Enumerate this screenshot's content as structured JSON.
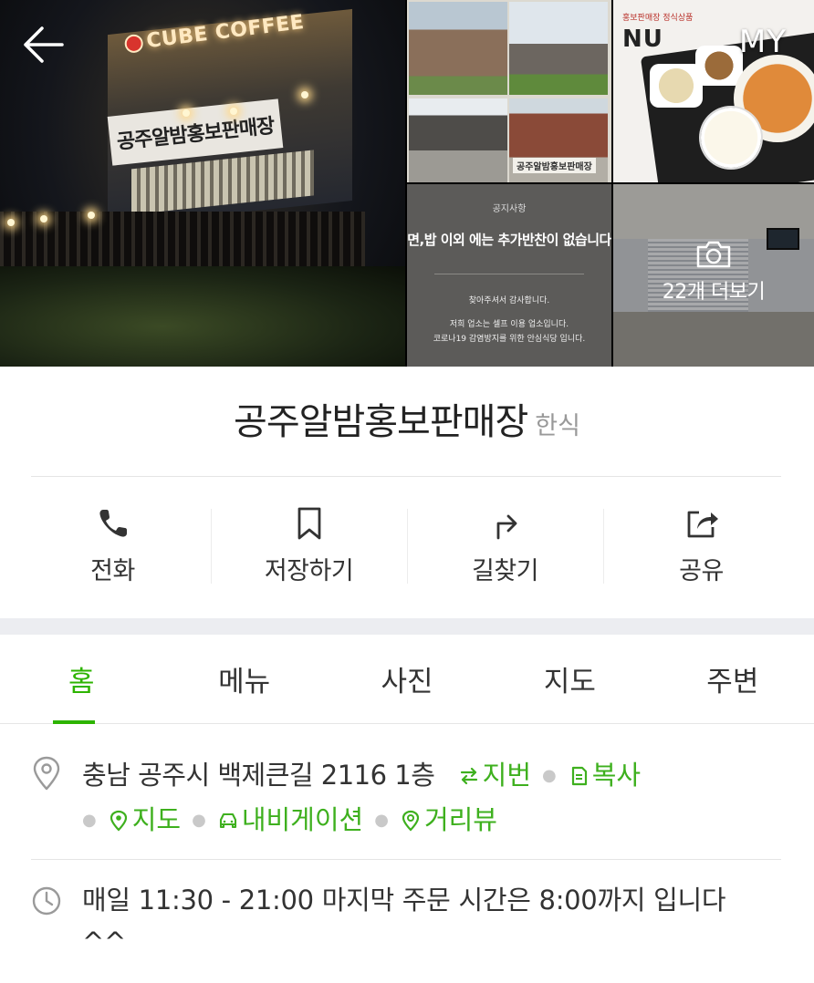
{
  "header": {
    "back_icon": "arrow-left-icon",
    "my_label": "MY"
  },
  "gallery": {
    "main_photo": {
      "brand_sign": "CUBE COFFEE",
      "store_sign": "공주알밤홍보판매장"
    },
    "thumb_building": {
      "sign_text": "공주알밤홍보판매장"
    },
    "thumb_menu": {
      "big_text": "NU",
      "small_text": "홍보판매장 정식상품"
    },
    "thumb_notice": {
      "title": "공지사항",
      "main": "면,밥 이외 에는 추가반찬이 없습니다",
      "sub_1": "찾아주셔서 감사합니다.",
      "sub_2": "저희 업소는 셀프 이용 업소입니다.",
      "sub_3": "코로나19 감염방지를 위한 안심식당 입니다."
    },
    "more_photos_label": "22개 더보기",
    "camera_icon": "camera-icon"
  },
  "place": {
    "name": "공주알밤홍보판매장",
    "category": "한식"
  },
  "actions": [
    {
      "label": "전화",
      "icon": "phone-icon"
    },
    {
      "label": "저장하기",
      "icon": "bookmark-icon"
    },
    {
      "label": "길찾기",
      "icon": "directions-icon"
    },
    {
      "label": "공유",
      "icon": "share-icon"
    }
  ],
  "tabs": [
    {
      "label": "홈",
      "active": true
    },
    {
      "label": "메뉴",
      "active": false
    },
    {
      "label": "사진",
      "active": false
    },
    {
      "label": "지도",
      "active": false
    },
    {
      "label": "주변",
      "active": false
    }
  ],
  "address": {
    "icon": "location-pin-icon",
    "text": "충남 공주시 백제큰길 2116 1층",
    "links": {
      "lot_number": "지번",
      "copy": "복사",
      "map": "지도",
      "navigation": "내비게이션",
      "street_view": "거리뷰"
    }
  },
  "hours": {
    "icon": "clock-icon",
    "text": "매일 11:30 - 21:00 마지막 주문 시간은 8:00까지 입니다^^"
  },
  "colors": {
    "accent_green": "#2db400",
    "link_green": "#3eb01e",
    "text": "#333333",
    "muted": "#999999",
    "divider_band": "#ecedf1"
  }
}
